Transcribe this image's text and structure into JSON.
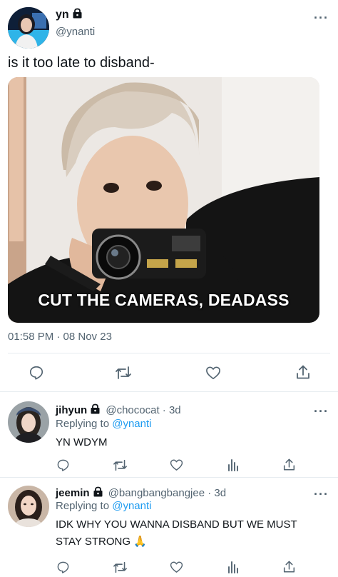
{
  "main_tweet": {
    "display_name": "yn",
    "handle": "@ynanti",
    "text": "is it too late to disband-",
    "media_caption": "CUT THE CAMERAS, DEADASS",
    "timestamp": "01:58 PM · 08 Nov 23",
    "avatar_icon": "avatar-girl-icon"
  },
  "replies": [
    {
      "display_name": "jihyun",
      "handle": "@chococat",
      "age": "· 3d",
      "replying_prefix": "Replying to",
      "replying_to": "@ynanti",
      "text_line1": "YN WDYM",
      "text_line2": ""
    },
    {
      "display_name": "jeemin",
      "handle": "@bangbangbangjee",
      "age": "· 3d",
      "replying_prefix": "Replying to",
      "replying_to": "@ynanti",
      "text_line1": "IDK WHY YOU WANNA DISBAND BUT WE MUST",
      "text_line2": "STAY STRONG 🙏"
    }
  ],
  "colors": {
    "accent": "#1d9bf0",
    "muted": "#536471",
    "divider": "#e6ecf0"
  }
}
